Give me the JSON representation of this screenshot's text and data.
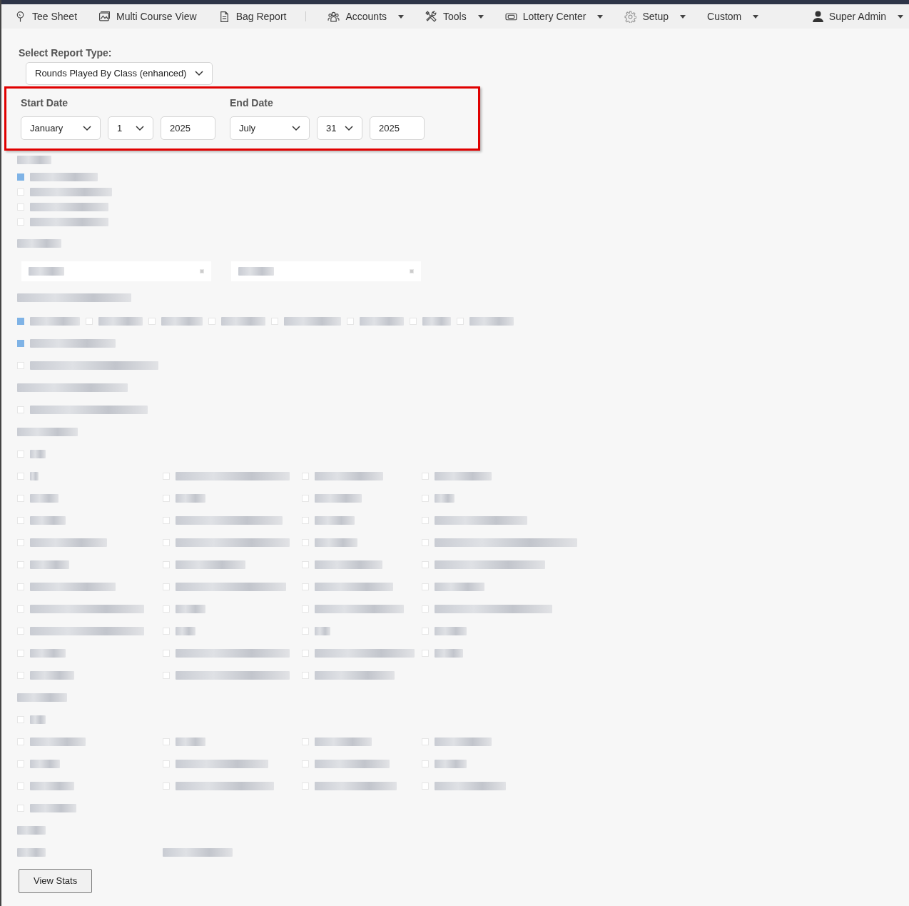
{
  "nav": {
    "items": [
      {
        "label": "Tee Sheet",
        "dropdown": false,
        "kind": "link"
      },
      {
        "label": "Multi Course View",
        "dropdown": false,
        "kind": "link"
      },
      {
        "label": "Bag Report",
        "dropdown": false,
        "kind": "link"
      },
      {
        "kind": "divider"
      },
      {
        "label": "Accounts",
        "dropdown": true,
        "kind": "link"
      },
      {
        "label": "Tools",
        "dropdown": true,
        "kind": "link"
      },
      {
        "label": "Lottery Center",
        "dropdown": true,
        "kind": "link"
      },
      {
        "label": "Setup",
        "dropdown": true,
        "kind": "link"
      },
      {
        "label": "Custom",
        "dropdown": true,
        "kind": "link"
      }
    ],
    "user": {
      "label": "Super Admin",
      "dropdown": true
    }
  },
  "report_type": {
    "label": "Select Report Type:",
    "value": "Rounds Played By Class (enhanced)"
  },
  "date_range": {
    "highlighted": true,
    "start": {
      "label": "Start Date",
      "month": "January",
      "day": "1",
      "year": "2025"
    },
    "end": {
      "label": "End Date",
      "month": "July",
      "day": "31",
      "year": "2025"
    }
  },
  "view_button": "View Stats",
  "redacted_checkboxes": [
    {
      "checked": true
    },
    {
      "checked": false
    },
    {
      "checked": false
    },
    {
      "checked": false
    },
    {
      "checked": true
    },
    {
      "checked": false
    },
    {
      "checked": false
    },
    {
      "checked": false
    },
    {
      "checked": false
    },
    {
      "checked": false
    },
    {
      "checked": false
    },
    {
      "checked": false
    },
    {
      "checked": true
    },
    {
      "checked": false
    },
    {
      "checked": false
    },
    {
      "checked": false
    },
    {
      "checked": false
    },
    {
      "checked": false
    },
    {
      "checked": false
    },
    {
      "checked": false
    },
    {
      "checked": false
    },
    {
      "checked": false
    },
    {
      "checked": false
    },
    {
      "checked": false
    },
    {
      "checked": false
    },
    {
      "checked": false
    },
    {
      "checked": false
    },
    {
      "checked": false
    },
    {
      "checked": false
    },
    {
      "checked": false
    },
    {
      "checked": false
    },
    {
      "checked": false
    },
    {
      "checked": false
    },
    {
      "checked": false
    },
    {
      "checked": false
    },
    {
      "checked": false
    },
    {
      "checked": false
    },
    {
      "checked": false
    },
    {
      "checked": false
    },
    {
      "checked": false
    },
    {
      "checked": false
    },
    {
      "checked": false
    },
    {
      "checked": false
    },
    {
      "checked": false
    },
    {
      "checked": false
    },
    {
      "checked": false
    },
    {
      "checked": false
    },
    {
      "checked": false
    },
    {
      "checked": false
    },
    {
      "checked": false
    },
    {
      "checked": false
    },
    {
      "checked": false
    },
    {
      "checked": false
    },
    {
      "checked": false
    },
    {
      "checked": false
    },
    {
      "checked": false
    },
    {
      "checked": false
    },
    {
      "checked": false
    },
    {
      "checked": false
    },
    {
      "checked": false
    },
    {
      "checked": false
    },
    {
      "checked": false
    },
    {
      "checked": false
    },
    {
      "checked": false
    },
    {
      "checked": false
    },
    {
      "checked": false
    },
    {
      "checked": false
    },
    {
      "checked": false
    },
    {
      "checked": false
    }
  ]
}
